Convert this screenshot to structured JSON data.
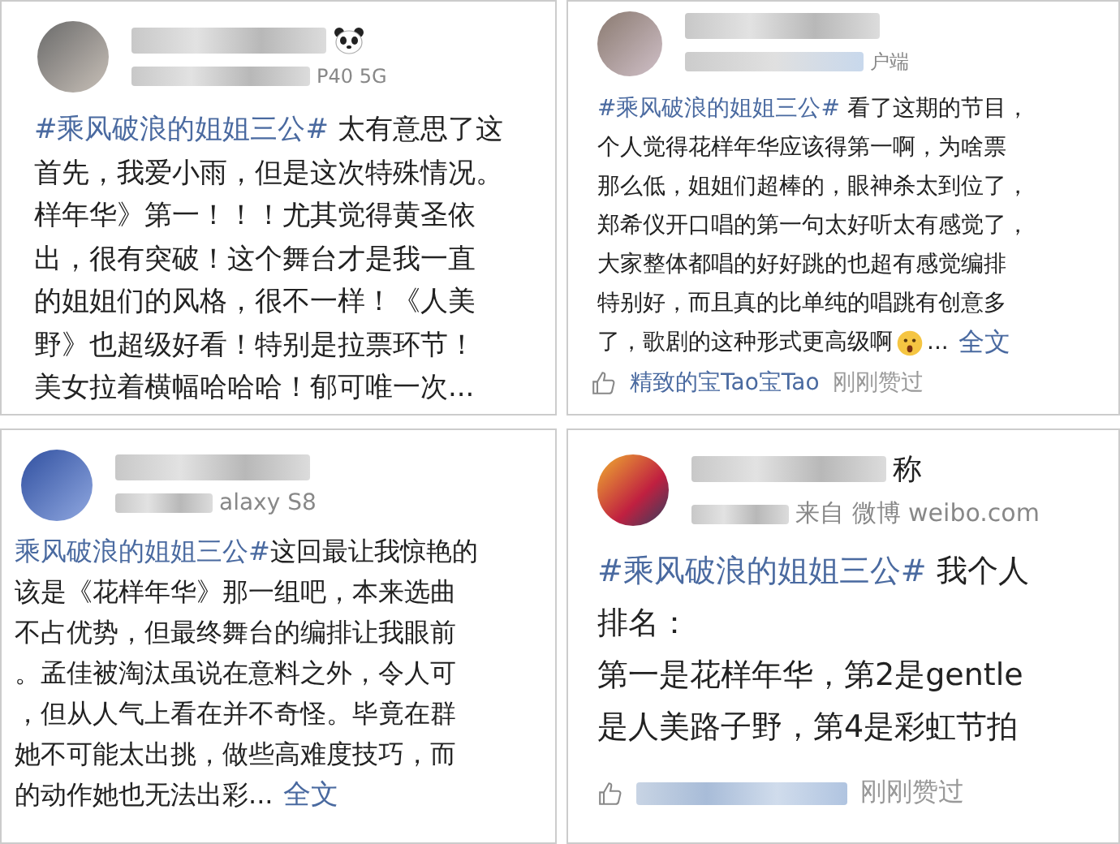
{
  "posts": [
    {
      "panda": true,
      "meta": "P40 5G",
      "hashtag": "#乘风破浪的姐姐三公#",
      "first_line": " 太有意思了这",
      "lines": [
        "首先，我爱小雨，但是这次特殊情况。",
        "样年华》第一！！！尤其觉得黄圣依",
        "出，很有突破！这个舞台才是我一直",
        "的姐姐们的风格，很不一样！《人美",
        "野》也超级好看！特别是拉票环节！",
        "美女拉着横幅哈哈哈！郁可唯一次..."
      ],
      "emoji": false
    },
    {
      "panda": false,
      "meta": "户端",
      "hashtag": "#乘风破浪的姐姐三公#",
      "first_line": " 看了这期的节目，",
      "lines": [
        "个人觉得花样年华应该得第一啊，为啥票",
        "那么低，姐姐们超棒的，眼神杀太到位了，",
        "郑希仪开口唱的第一句太好听太有感觉了，",
        "大家整体都唱的好好跳的也超有感觉编排",
        "特别好，而且真的比单纯的唱跳有创意多",
        "了，歌剧的这种形式更高级啊"
      ],
      "emoji": true,
      "ellipsis": "...",
      "more": "全文",
      "liked_by": {
        "name": "精致的宝Tao宝Tao",
        "text": "刚刚赞过"
      }
    },
    {
      "panda": false,
      "meta": "alaxy S8",
      "hashtag": "乘风破浪的姐姐三公#",
      "first_line": "这回最让我惊艳的",
      "lines": [
        "该是《花样年华》那一组吧，本来选曲",
        "不占优势，但最终舞台的编排让我眼前",
        "。孟佳被淘汰虽说在意料之外，令人可",
        "，但从人气上看在并不奇怪。毕竟在群",
        "她不可能太出挑，做些高难度技巧，而",
        "的动作她也无法出彩..."
      ],
      "emoji": false,
      "more": "全文"
    },
    {
      "name_tail": "称",
      "panda": false,
      "meta": "来自 微博 weibo.com",
      "hashtag": "#乘风破浪的姐姐三公#",
      "first_line": " 我个人",
      "lines": [
        "排名：",
        "第一是花样年华，第2是gentle",
        "是人美路子野，第4是彩虹节拍"
      ],
      "emoji": false,
      "liked_by": {
        "text": "刚刚赞过"
      }
    }
  ]
}
